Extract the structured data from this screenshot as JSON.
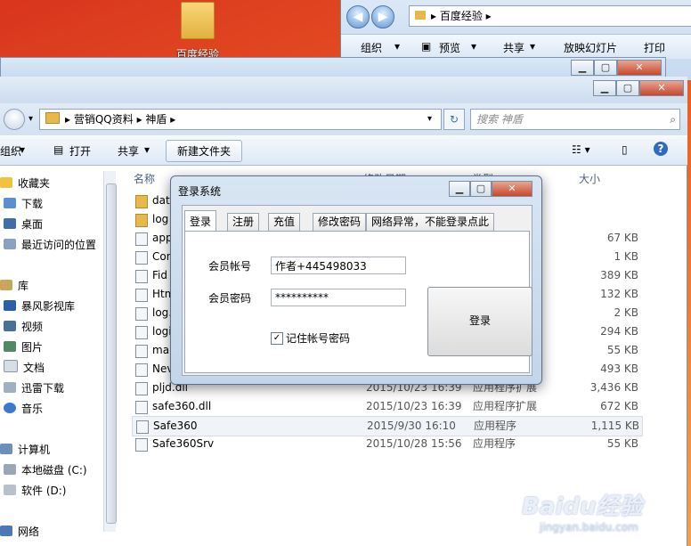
{
  "desktop": {
    "icon_label": "百度经验"
  },
  "back_window": {
    "path": "百度经验",
    "toolbar": [
      "组织",
      "预览",
      "共享",
      "放映幻灯片",
      "打印"
    ]
  },
  "main_window": {
    "breadcrumb": [
      "营销QQ资料",
      "神盾"
    ],
    "search_placeholder": "搜索 神盾",
    "toolbar": {
      "organize": "组织",
      "open": "打开",
      "share": "共享",
      "new_folder": "新建文件夹"
    },
    "nav": {
      "favorites": "收藏夹",
      "favorite_items": [
        "下载",
        "桌面",
        "最近访问的位置"
      ],
      "libraries": "库",
      "library_items": [
        "暴风影视库",
        "视频",
        "图片",
        "文档",
        "迅雷下载",
        "音乐"
      ],
      "computer": "计算机",
      "drives": [
        "本地磁盘 (C:)",
        "软件 (D:)"
      ],
      "network": "网络"
    },
    "columns": {
      "name": "名称",
      "date": "修改日期",
      "type": "类型",
      "size": "大小"
    },
    "files": [
      {
        "name": "dat",
        "date": "",
        "type": "",
        "size": ""
      },
      {
        "name": "log",
        "date": "",
        "type": "",
        "size": ""
      },
      {
        "name": "app",
        "date": "",
        "type": "",
        "size": "67 KB"
      },
      {
        "name": "Con",
        "date": "",
        "type": "",
        "size": "1 KB"
      },
      {
        "name": "Fid",
        "date": "",
        "type": "",
        "size": "389 KB"
      },
      {
        "name": "Htm",
        "date": "",
        "type": "",
        "size": "132 KB"
      },
      {
        "name": "log.",
        "date": "",
        "type": "",
        "size": "2 KB"
      },
      {
        "name": "logi",
        "date": "",
        "type": "",
        "size": "294 KB"
      },
      {
        "name": "ma",
        "date": "",
        "type": "",
        "size": "55 KB"
      },
      {
        "name": "Nev",
        "date": "",
        "type": "",
        "size": "493 KB"
      },
      {
        "name": "pljd.dll",
        "date": "2015/10/23 16:39",
        "type": "应用程序扩展",
        "size": "3,436 KB"
      },
      {
        "name": "safe360.dll",
        "date": "2015/10/23 16:39",
        "type": "应用程序扩展",
        "size": "672 KB"
      },
      {
        "name": "Safe360",
        "date": "2015/9/30 16:10",
        "type": "应用程序",
        "size": "1,115 KB"
      },
      {
        "name": "Safe360Srv",
        "date": "2015/10/28 15:56",
        "type": "应用程序",
        "size": "55 KB"
      }
    ]
  },
  "dialog": {
    "title": "登录系统",
    "tabs": [
      "登录",
      "注册",
      "充值",
      "修改密码",
      "网络异常，不能登录点此"
    ],
    "account_label": "会员帐号",
    "account_value": "作者+445498033",
    "password_label": "会员密码",
    "password_value": "**********",
    "login_button": "登录",
    "remember_label": "记住帐号密码"
  },
  "watermark": {
    "brand": "Baidu经验",
    "url": "jingyan.baidu.com"
  }
}
